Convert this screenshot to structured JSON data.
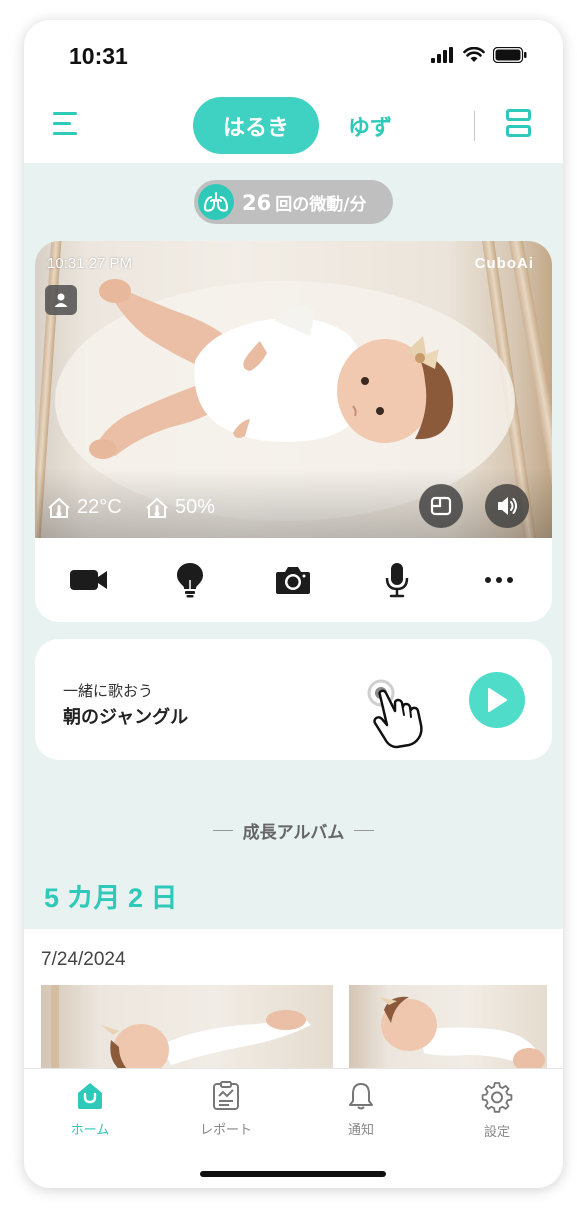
{
  "status_bar": {
    "time": "10:31"
  },
  "header": {
    "menu_icon": "hamburger-menu-icon",
    "tabs": [
      {
        "label": "はるき",
        "active": true
      },
      {
        "label": "ゆず",
        "active": false
      }
    ],
    "layout_icon": "split-layout-icon"
  },
  "breathing": {
    "count": "26",
    "unit": "回の微動/分",
    "icon": "lungs-icon"
  },
  "camera": {
    "timestamp": "10:31:27 PM",
    "brand": "CuboAi",
    "temperature": "22°C",
    "humidity": "50%",
    "toolbar": [
      "video-icon",
      "lightbulb-icon",
      "camera-icon",
      "microphone-icon",
      "more-icon"
    ]
  },
  "song": {
    "subtitle": "一緒に歌おう",
    "title": "朝のジャングル"
  },
  "album": {
    "heading": "成長アルバム",
    "age": "5 カ月 2 日",
    "date": "7/24/2024"
  },
  "tab_bar": {
    "items": [
      {
        "label": "ホーム",
        "icon": "home-icon",
        "active": true
      },
      {
        "label": "レポート",
        "icon": "report-icon",
        "active": false
      },
      {
        "label": "通知",
        "icon": "bell-icon",
        "active": false
      },
      {
        "label": "設定",
        "icon": "gear-icon",
        "active": false
      }
    ]
  },
  "colors": {
    "accent": "#2ec9b8",
    "background": "#e8f3f1",
    "play": "#4fdcc9"
  }
}
